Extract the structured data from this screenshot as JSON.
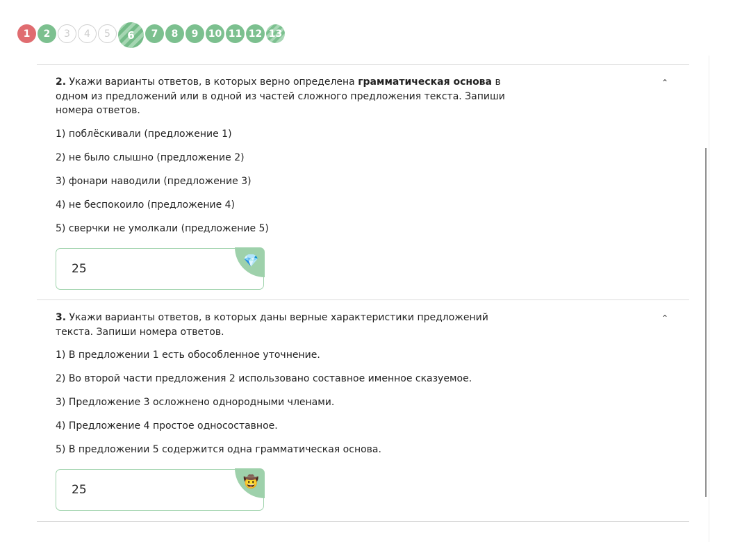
{
  "steps": [
    {
      "label": "1",
      "state": "error"
    },
    {
      "label": "2",
      "state": "done"
    },
    {
      "label": "3",
      "state": "empty"
    },
    {
      "label": "4",
      "state": "empty"
    },
    {
      "label": "5",
      "state": "empty"
    },
    {
      "label": "6",
      "state": "current"
    },
    {
      "label": "7",
      "state": "done"
    },
    {
      "label": "8",
      "state": "done"
    },
    {
      "label": "9",
      "state": "done"
    },
    {
      "label": "10",
      "state": "done"
    },
    {
      "label": "11",
      "state": "done"
    },
    {
      "label": "12",
      "state": "done"
    },
    {
      "label": "13",
      "state": "partial"
    }
  ],
  "colors": {
    "correct": "#7cc08f",
    "error": "#e06c70",
    "border": "#9fd3ac"
  },
  "questions": [
    {
      "number": "2.",
      "text_before": "Укажи варианты ответов, в которых верно определена",
      "text_bold": "грамматическая основа",
      "text_after": "в одном из предложений или в одной из частей сложного предложения текста. Запиши номера ответов.",
      "options": [
        "1) поблёскивали (предложение 1)",
        "2) не было слышно (предложение 2)",
        "3) фонари наводили (предложение 3)",
        "4) не беспокоило (предложение 4)",
        "5) сверчки не умолкали (предложение 5)"
      ],
      "answer": "25",
      "badge_icon": "💎",
      "badge_icon_name": "gem-icon"
    },
    {
      "number": "3.",
      "text_before": "Укажи варианты ответов, в которых даны верные характеристики предложений текста. Запиши номера ответов.",
      "text_bold": "",
      "text_after": "",
      "options": [
        "1) В предложении 1 есть обособленное уточнение.",
        "2) Во второй части предложения 2 использовано составное именное сказуемое.",
        "3) Предложение 3 осложнено однородными членами.",
        "4) Предложение 4 простое односоставное.",
        "5) В предложении 5 содержится одна грамматическая основа."
      ],
      "answer": "25",
      "badge_icon": "🤠",
      "badge_icon_name": "cowboy-face-icon"
    }
  ]
}
